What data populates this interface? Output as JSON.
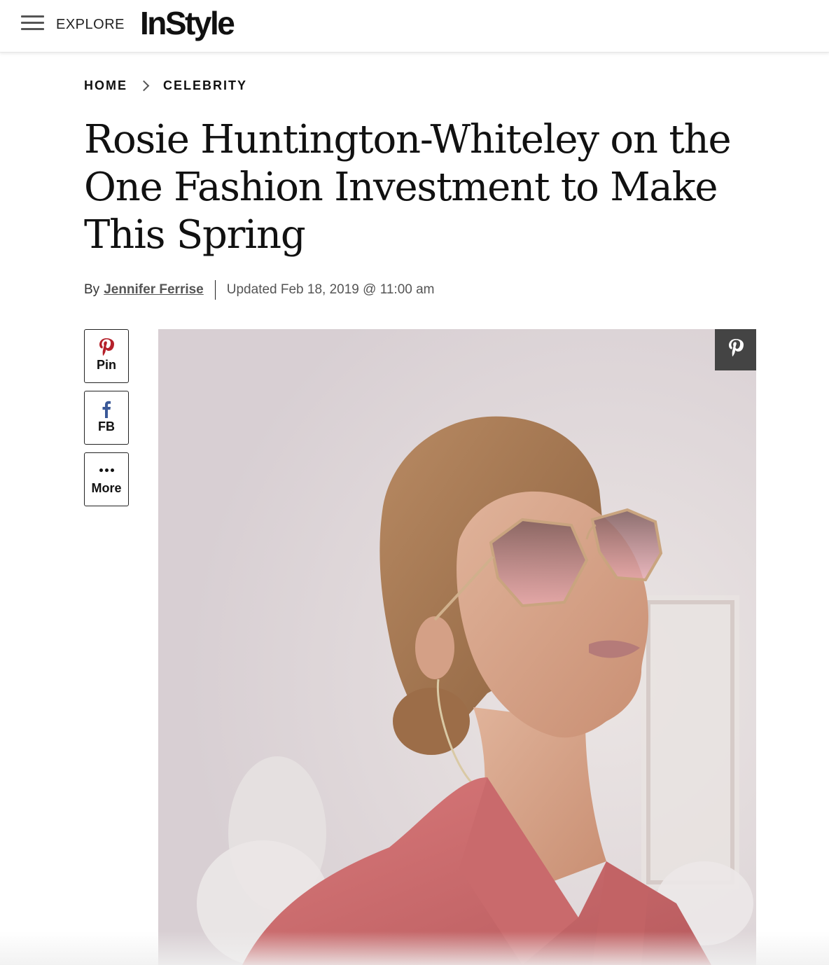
{
  "header": {
    "menu_icon": "hamburger-menu-icon",
    "explore_label": "EXPLORE",
    "logo_text": "InStyle"
  },
  "breadcrumb": {
    "items": [
      "HOME",
      "CELEBRITY"
    ],
    "separator_icon": "chevron-right-icon"
  },
  "article": {
    "title": "Rosie Huntington-Whiteley on the One Fashion Investment to Make This Spring",
    "byline_prefix": "By",
    "author": "Jennifer Ferrise",
    "updated": "Updated Feb 18, 2019 @ 11:00 am"
  },
  "share": {
    "pin_label": "Pin",
    "fb_label": "FB",
    "more_label": "More"
  },
  "hero": {
    "description_icon": "hero-photo",
    "pin_overlay_icon": "pinterest-icon"
  },
  "colors": {
    "pinterest": "#b5202a",
    "facebook": "#3b5998",
    "pin_overlay_bg": "#444444"
  }
}
